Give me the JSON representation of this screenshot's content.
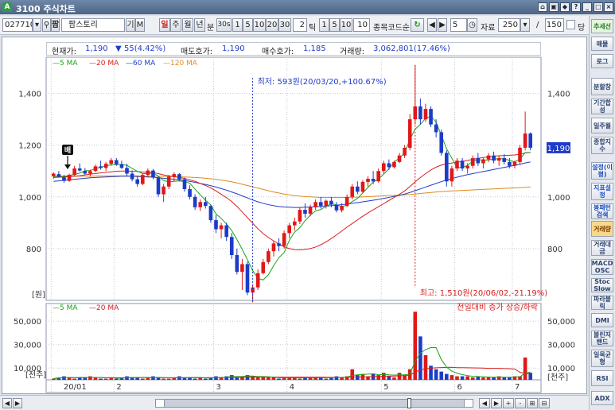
{
  "window": {
    "title": "3100 주식차트",
    "app_icon": "A"
  },
  "toolbar": {
    "code": "027710",
    "stock_name": "팜스토리",
    "btn_gi": "기",
    "btn_m": "M",
    "periods": [
      "일",
      "주",
      "월",
      "년",
      "분",
      "30s"
    ],
    "minutes": [
      "1",
      "5",
      "10",
      "20",
      "30"
    ],
    "tick_value": "2",
    "tick_label": "틱",
    "ticks": [
      "1",
      "5",
      "10"
    ],
    "ticks_value": "10",
    "code_search_label": "종목코드순",
    "step_value": "5",
    "data_label": "자료",
    "data_count": "250",
    "slash": "/",
    "view_count": "150",
    "dang_label": "당"
  },
  "info": {
    "current_label": "현재가:",
    "current_value": "1,190",
    "change_arrow": "▼",
    "change_value": "55(4.42%)",
    "ask_label": "매도호가:",
    "ask_value": "1,190",
    "bid_label": "매수호가:",
    "bid_value": "1,185",
    "volume_label": "거래량:",
    "volume_value": "3,062,801(17.46%)"
  },
  "chart_data": {
    "type": "candlestick",
    "price_axis": {
      "ticks": [
        "1,400",
        "1,200",
        "1,000",
        "800"
      ],
      "unit": "[원]",
      "ylim": [
        600,
        1540
      ]
    },
    "volume_axis": {
      "ticks": [
        "50,000",
        "30,000",
        "10,000"
      ],
      "unit": "[천주]"
    },
    "x_ticks": [
      "20/01",
      "2",
      "3",
      "4",
      "5",
      "6",
      "7"
    ],
    "legend_price": [
      {
        "name": "5 MA",
        "color": "#1aa31a"
      },
      {
        "name": "20 MA",
        "color": "#d81e1e"
      },
      {
        "name": "60 MA",
        "color": "#1e3cc8"
      },
      {
        "name": "120 MA",
        "color": "#e08a1c"
      }
    ],
    "legend_volume": [
      {
        "name": "5 MA",
        "color": "#1aa31a"
      },
      {
        "name": "20 MA",
        "color": "#d81e1e"
      }
    ],
    "volume_note": "전일대비 증가 상승/하락",
    "annotation_low": "최저: 593원(20/03/20,+100.67%)",
    "annotation_high": "최고: 1,510원(20/06/02,-21.19%)",
    "marker_label": "배",
    "current_price_tag": "1,190",
    "candles": [
      [
        1080,
        1095,
        1070,
        1090
      ],
      [
        1088,
        1100,
        1075,
        1078
      ],
      [
        1076,
        1085,
        1055,
        1062
      ],
      [
        1062,
        1090,
        1058,
        1085
      ],
      [
        1085,
        1120,
        1080,
        1110
      ],
      [
        1110,
        1130,
        1098,
        1102
      ],
      [
        1100,
        1112,
        1085,
        1090
      ],
      [
        1090,
        1105,
        1078,
        1100
      ],
      [
        1100,
        1125,
        1095,
        1118
      ],
      [
        1118,
        1140,
        1105,
        1112
      ],
      [
        1112,
        1135,
        1100,
        1128
      ],
      [
        1128,
        1150,
        1120,
        1142
      ],
      [
        1142,
        1150,
        1120,
        1126
      ],
      [
        1126,
        1140,
        1108,
        1112
      ],
      [
        1112,
        1128,
        1080,
        1090
      ],
      [
        1090,
        1102,
        1060,
        1068
      ],
      [
        1068,
        1080,
        1040,
        1050
      ],
      [
        1050,
        1090,
        1045,
        1085
      ],
      [
        1085,
        1110,
        1078,
        1102
      ],
      [
        1102,
        1108,
        1068,
        1075
      ],
      [
        1075,
        1080,
        1000,
        1010
      ],
      [
        1010,
        1050,
        980,
        1040
      ],
      [
        1040,
        1085,
        1030,
        1078
      ],
      [
        1078,
        1095,
        1060,
        1088
      ],
      [
        1088,
        1092,
        1060,
        1068
      ],
      [
        1068,
        1075,
        1020,
        1030
      ],
      [
        1030,
        1045,
        990,
        1000
      ],
      [
        1000,
        1010,
        950,
        960
      ],
      [
        960,
        990,
        945,
        980
      ],
      [
        980,
        1000,
        955,
        965
      ],
      [
        965,
        970,
        900,
        910
      ],
      [
        910,
        930,
        860,
        875
      ],
      [
        875,
        900,
        840,
        890
      ],
      [
        890,
        900,
        830,
        845
      ],
      [
        845,
        860,
        760,
        775
      ],
      [
        775,
        800,
        700,
        710
      ],
      [
        710,
        760,
        640,
        740
      ],
      [
        740,
        750,
        620,
        630
      ],
      [
        630,
        660,
        593,
        650
      ],
      [
        650,
        720,
        640,
        705
      ],
      [
        705,
        760,
        700,
        748
      ],
      [
        748,
        800,
        740,
        790
      ],
      [
        790,
        830,
        770,
        820
      ],
      [
        820,
        840,
        790,
        810
      ],
      [
        810,
        870,
        800,
        860
      ],
      [
        860,
        900,
        840,
        890
      ],
      [
        890,
        920,
        870,
        905
      ],
      [
        905,
        960,
        895,
        950
      ],
      [
        950,
        975,
        920,
        935
      ],
      [
        935,
        970,
        925,
        960
      ],
      [
        960,
        990,
        950,
        980
      ],
      [
        980,
        1000,
        955,
        965
      ],
      [
        965,
        990,
        955,
        985
      ],
      [
        985,
        1000,
        960,
        970
      ],
      [
        970,
        980,
        940,
        948
      ],
      [
        948,
        975,
        940,
        965
      ],
      [
        965,
        1010,
        960,
        1000
      ],
      [
        1000,
        1050,
        990,
        1040
      ],
      [
        1040,
        1060,
        1010,
        1020
      ],
      [
        1020,
        1065,
        1015,
        1058
      ],
      [
        1058,
        1080,
        1040,
        1070
      ],
      [
        1070,
        1100,
        1050,
        1060
      ],
      [
        1060,
        1110,
        1055,
        1100
      ],
      [
        1100,
        1140,
        1090,
        1130
      ],
      [
        1130,
        1145,
        1105,
        1115
      ],
      [
        1115,
        1140,
        1110,
        1135
      ],
      [
        1135,
        1170,
        1130,
        1160
      ],
      [
        1160,
        1200,
        1150,
        1190
      ],
      [
        1190,
        1320,
        1180,
        1300
      ],
      [
        1300,
        1510,
        1280,
        1350
      ],
      [
        1350,
        1380,
        1280,
        1300
      ],
      [
        1300,
        1360,
        1290,
        1340
      ],
      [
        1340,
        1350,
        1270,
        1280
      ],
      [
        1280,
        1300,
        1230,
        1250
      ],
      [
        1250,
        1260,
        1160,
        1170
      ],
      [
        1170,
        1180,
        1040,
        1060
      ],
      [
        1060,
        1120,
        1040,
        1110
      ],
      [
        1110,
        1150,
        1100,
        1140
      ],
      [
        1140,
        1150,
        1100,
        1110
      ],
      [
        1110,
        1130,
        1090,
        1120
      ],
      [
        1120,
        1160,
        1110,
        1150
      ],
      [
        1150,
        1170,
        1120,
        1130
      ],
      [
        1130,
        1150,
        1110,
        1145
      ],
      [
        1145,
        1170,
        1135,
        1160
      ],
      [
        1160,
        1175,
        1130,
        1140
      ],
      [
        1140,
        1160,
        1120,
        1150
      ],
      [
        1150,
        1165,
        1125,
        1135
      ],
      [
        1135,
        1150,
        1110,
        1120
      ],
      [
        1120,
        1140,
        1110,
        1135
      ],
      [
        1135,
        1200,
        1125,
        1190
      ],
      [
        1190,
        1330,
        1180,
        1245
      ],
      [
        1245,
        1250,
        1180,
        1190
      ]
    ],
    "volumes": [
      1,
      2,
      3,
      2,
      1,
      2,
      2,
      3,
      2,
      1,
      1,
      2,
      1,
      2,
      3,
      2,
      2,
      1,
      2,
      3,
      2,
      1,
      1,
      2,
      3,
      2,
      2,
      1,
      2,
      1,
      2,
      3,
      2,
      3,
      4,
      2,
      3,
      4,
      3,
      2,
      2,
      2,
      2,
      1,
      2,
      2,
      2,
      1,
      2,
      2,
      2,
      2,
      1,
      2,
      3,
      2,
      3,
      9,
      4,
      5,
      3,
      5,
      4,
      6,
      3,
      2,
      6,
      4,
      9,
      58,
      37,
      21,
      12,
      9,
      7,
      5,
      4,
      3,
      3,
      3,
      2,
      3,
      2,
      2,
      2,
      3,
      2,
      2,
      3,
      3,
      19,
      6
    ],
    "ma5": [
      1078,
      1080,
      1079,
      1083,
      1087,
      1092,
      1101,
      1102,
      1110,
      1114,
      1120,
      1124,
      1125,
      1126,
      1122,
      1110,
      1099,
      1090,
      1090,
      1093,
      1080,
      1063,
      1058,
      1060,
      1062,
      1059,
      1053,
      1030,
      1008,
      987,
      969,
      934,
      917,
      895,
      870,
      835,
      797,
      757,
      715,
      685,
      679,
      699,
      734,
      765,
      785,
      832,
      864,
      881,
      908,
      929,
      946,
      951,
      964,
      973,
      970,
      962,
      968,
      982,
      994,
      1015,
      1037,
      1057,
      1069,
      1088,
      1108,
      1135,
      1150,
      1170,
      1222,
      1262,
      1280,
      1304,
      1312,
      1289,
      1238,
      1186,
      1150,
      1113,
      1114,
      1122,
      1138,
      1144,
      1142,
      1143,
      1146,
      1148,
      1147,
      1141,
      1135,
      1147,
      1171,
      1172
    ],
    "ma20": [
      1075,
      1076,
      1077,
      1078,
      1080,
      1082,
      1085,
      1088,
      1090,
      1093,
      1095,
      1097,
      1099,
      1100,
      1100,
      1099,
      1098,
      1096,
      1095,
      1094,
      1090,
      1085,
      1081,
      1078,
      1075,
      1071,
      1066,
      1060,
      1052,
      1044,
      1035,
      1023,
      1010,
      997,
      982,
      963,
      942,
      920,
      898,
      877,
      858,
      843,
      830,
      818,
      807,
      800,
      796,
      795,
      797,
      800,
      806,
      815,
      826,
      839,
      853,
      868,
      883,
      897,
      911,
      925,
      938,
      950,
      962,
      974,
      986,
      998,
      1010,
      1023,
      1040,
      1058,
      1075,
      1090,
      1104,
      1115,
      1123,
      1128,
      1131,
      1134,
      1137,
      1141,
      1145,
      1149,
      1152,
      1155,
      1157,
      1159,
      1160,
      1161,
      1162,
      1165,
      1170,
      1172
    ],
    "ma60": [
      1060,
      1062,
      1064,
      1066,
      1068,
      1070,
      1072,
      1074,
      1075,
      1076,
      1077,
      1078,
      1079,
      1080,
      1080,
      1080,
      1079,
      1078,
      1077,
      1076,
      1074,
      1072,
      1070,
      1068,
      1066,
      1063,
      1060,
      1056,
      1052,
      1048,
      1043,
      1038,
      1032,
      1026,
      1019,
      1012,
      1004,
      996,
      988,
      981,
      975,
      970,
      966,
      963,
      961,
      960,
      959,
      959,
      960,
      961,
      962,
      963,
      964,
      966,
      968,
      970,
      972,
      975,
      978,
      981,
      984,
      987,
      990,
      994,
      998,
      1002,
      1006,
      1011,
      1017,
      1024,
      1031,
      1038,
      1045,
      1052,
      1059,
      1065,
      1071,
      1076,
      1081,
      1086,
      1090,
      1094,
      1098,
      1102,
      1106,
      1110,
      1114,
      1118,
      1122,
      1126,
      1131,
      1135
    ],
    "ma120": [
      1080,
      1080,
      1080,
      1080,
      1080,
      1080,
      1080,
      1080,
      1081,
      1081,
      1081,
      1081,
      1081,
      1081,
      1081,
      1081,
      1081,
      1080,
      1080,
      1080,
      1080,
      1079,
      1079,
      1078,
      1078,
      1077,
      1076,
      1075,
      1074,
      1072,
      1070,
      1068,
      1065,
      1062,
      1058,
      1054,
      1049,
      1044,
      1039,
      1034,
      1029,
      1024,
      1019,
      1015,
      1011,
      1008,
      1005,
      1003,
      1001,
      1000,
      999,
      998,
      998,
      998,
      998,
      998,
      998,
      999,
      999,
      1000,
      1001,
      1002,
      1003,
      1004,
      1005,
      1006,
      1007,
      1008,
      1009,
      1011,
      1013,
      1015,
      1017,
      1019,
      1021,
      1022,
      1023,
      1024,
      1025,
      1026,
      1027,
      1028,
      1029,
      1030,
      1031,
      1032,
      1033,
      1034,
      1035,
      1036,
      1037,
      1038
    ]
  },
  "right_panel": [
    "추세선",
    "매물",
    "로그",
    "분할창",
    "기간합성",
    "일주월",
    "종합지수",
    "설정(이평)",
    "지표설정",
    "봉패턴검색",
    "거래량",
    "거래대금",
    "MACD OSC",
    "Stoc Slow",
    "파라볼릭",
    "DMI",
    "볼린저밴드",
    "일목균형",
    "RSI",
    "ADX"
  ],
  "bottom": {
    "left_btns": [
      "◀",
      "▶"
    ],
    "right_btns": [
      "◀",
      "▶",
      "+",
      "-",
      "⊞",
      "⊟"
    ]
  }
}
